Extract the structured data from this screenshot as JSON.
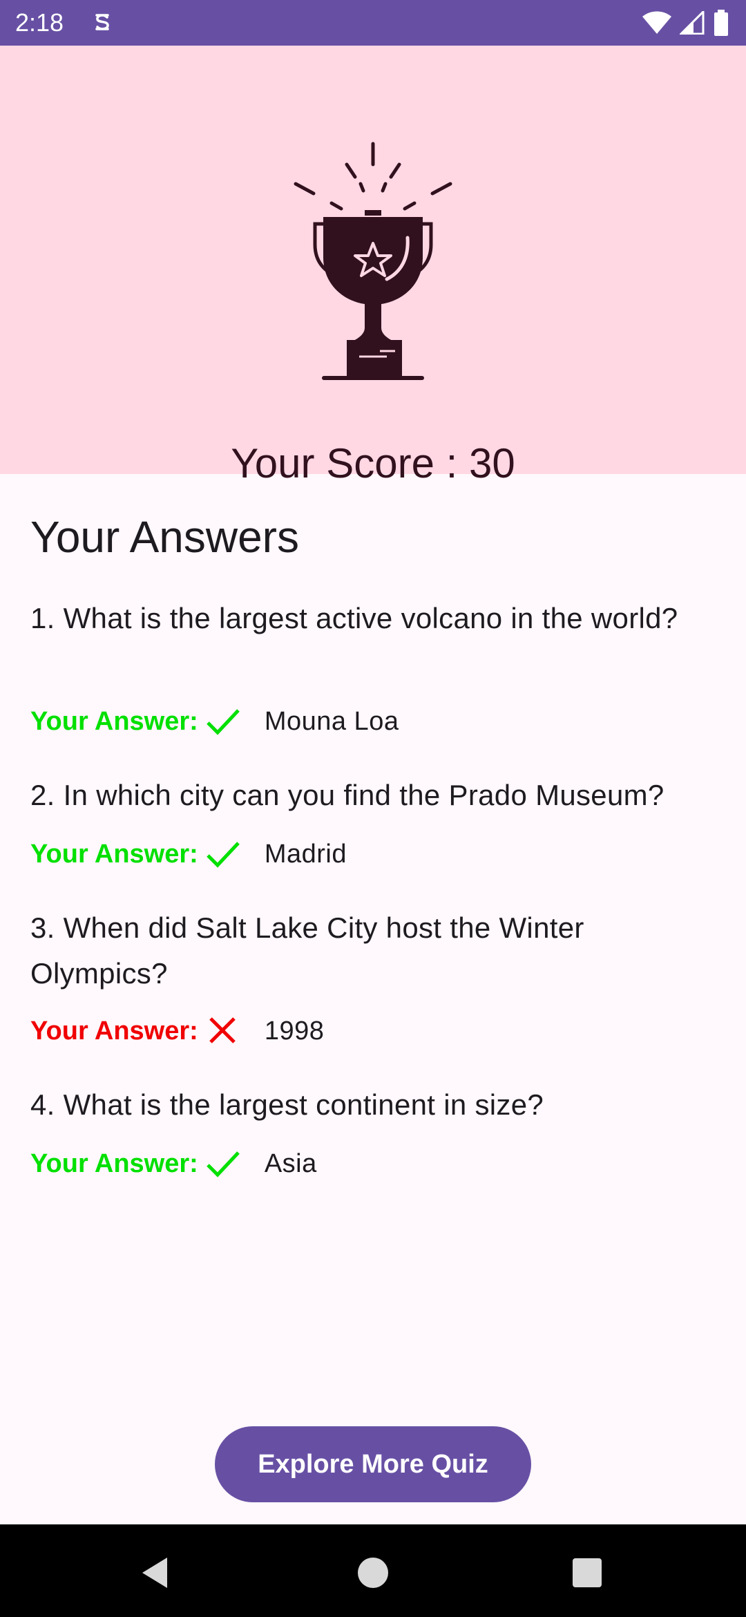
{
  "status_bar": {
    "time": "2:18"
  },
  "header": {
    "score_text": "Your Score : 30"
  },
  "answers": {
    "title": "Your Answers",
    "items": [
      {
        "question": "1. What is the largest active volcano in the world?",
        "label": "Your Answer:",
        "value": "Mouna Loa",
        "correct": true
      },
      {
        "question": "2. In which city can you find the Prado Museum?",
        "label": "Your Answer:",
        "value": "Madrid",
        "correct": true
      },
      {
        "question": "3. When did Salt Lake City host the Winter Olympics?",
        "label": "Your Answer:",
        "value": "1998",
        "correct": false
      },
      {
        "question": "4. What is the largest continent in size?",
        "label": "Your Answer:",
        "value": "Asia",
        "correct": true
      }
    ]
  },
  "explore_button": {
    "label": "Explore More Quiz"
  },
  "colors": {
    "accent": "#6750a4",
    "header_bg": "#ffd8e4",
    "correct": "#00e000",
    "wrong": "#f00000"
  },
  "icons": [
    "trophy-icon",
    "check-icon",
    "cross-icon",
    "wifi-icon",
    "signal-icon",
    "battery-icon",
    "back-icon",
    "home-icon",
    "recents-icon"
  ]
}
